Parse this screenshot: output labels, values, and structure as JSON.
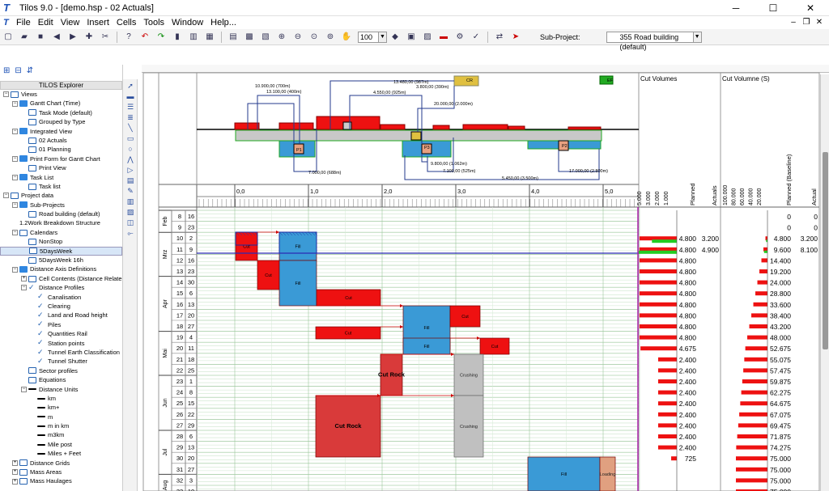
{
  "window": {
    "title": "Tilos 9.0 - [demo.hsp - 02 Actuals]",
    "minimize": "─",
    "maximize": "☐",
    "close": "✕"
  },
  "menu": [
    "File",
    "Edit",
    "View",
    "Insert",
    "Cells",
    "Tools",
    "Window",
    "Help..."
  ],
  "mdi": {
    "minimize": "–",
    "restore": "❐",
    "close": "✕"
  },
  "toolbar": {
    "zoom": "100",
    "subproject_label": "Sub-Project:",
    "subproject_value": "355 Road building (default)"
  },
  "explorer": {
    "header": "TILOS Explorer",
    "items": [
      {
        "t": "Views",
        "lvl": 0,
        "exp": "-",
        "ic": "doc"
      },
      {
        "t": "Gantt Chart (Time)",
        "lvl": 1,
        "exp": "-",
        "ic": "fold"
      },
      {
        "t": "Task Mode (default)",
        "lvl": 2,
        "ic": "doc"
      },
      {
        "t": "Grouped by Type",
        "lvl": 2,
        "ic": "doc"
      },
      {
        "t": "Integrated View",
        "lvl": 1,
        "exp": "-",
        "ic": "fold"
      },
      {
        "t": "02 Actuals",
        "lvl": 2,
        "ic": "doc"
      },
      {
        "t": "01 Planning",
        "lvl": 2,
        "ic": "doc"
      },
      {
        "t": "Print Form for Gantt Chart",
        "lvl": 1,
        "exp": "-",
        "ic": "fold"
      },
      {
        "t": "Print View",
        "lvl": 2,
        "ic": "doc"
      },
      {
        "t": "Task List",
        "lvl": 1,
        "exp": "-",
        "ic": "fold"
      },
      {
        "t": "Task list",
        "lvl": 2,
        "ic": "doc"
      },
      {
        "t": "Project data",
        "lvl": 0,
        "exp": "-",
        "ic": "doc"
      },
      {
        "t": "Sub-Projects",
        "lvl": 1,
        "exp": "-",
        "ic": "fold"
      },
      {
        "t": "Road building (default)",
        "lvl": 2,
        "ic": "doc"
      },
      {
        "t": "Work Breakdown Structure",
        "lvl": 1,
        "ic": "none",
        "pre": "1.2"
      },
      {
        "t": "Calendars",
        "lvl": 1,
        "exp": "-",
        "ic": "doc"
      },
      {
        "t": "NonStop",
        "lvl": 2,
        "ic": "doc"
      },
      {
        "t": "5DaysWeek",
        "lvl": 2,
        "ic": "doc",
        "sel": true
      },
      {
        "t": "5DaysWeek 16h",
        "lvl": 2,
        "ic": "doc"
      },
      {
        "t": "Distance Axis Definitions",
        "lvl": 1,
        "exp": "-",
        "ic": "fold"
      },
      {
        "t": "Cell Contents (Distance Relate",
        "lvl": 2,
        "exp": "+",
        "ic": "doc"
      },
      {
        "t": "Distance Profiles",
        "lvl": 2,
        "exp": "-",
        "ic": "chk"
      },
      {
        "t": "Canalisation",
        "lvl": 3,
        "ic": "chk"
      },
      {
        "t": "Clearing",
        "lvl": 3,
        "ic": "chk"
      },
      {
        "t": "Land and Road height",
        "lvl": 3,
        "ic": "chk"
      },
      {
        "t": "Piles",
        "lvl": 3,
        "ic": "chk"
      },
      {
        "t": "Quantities Rail",
        "lvl": 3,
        "ic": "chk"
      },
      {
        "t": "Station points",
        "lvl": 3,
        "ic": "chk"
      },
      {
        "t": "Tunnel Earth Classification",
        "lvl": 3,
        "ic": "chk"
      },
      {
        "t": "Tunnel Shutter",
        "lvl": 3,
        "ic": "chk"
      },
      {
        "t": "Sector profiles",
        "lvl": 2,
        "ic": "doc"
      },
      {
        "t": "Equations",
        "lvl": 2,
        "ic": "doc"
      },
      {
        "t": "Distance Units",
        "lvl": 2,
        "exp": "-",
        "ic": "line"
      },
      {
        "t": "km",
        "lvl": 3,
        "ic": "line"
      },
      {
        "t": "km+",
        "lvl": 3,
        "ic": "line"
      },
      {
        "t": "m",
        "lvl": 3,
        "ic": "line"
      },
      {
        "t": "m in km",
        "lvl": 3,
        "ic": "line"
      },
      {
        "t": "m3km",
        "lvl": 3,
        "ic": "line"
      },
      {
        "t": "Mile post",
        "lvl": 3,
        "ic": "line"
      },
      {
        "t": "Miles + Feet",
        "lvl": 3,
        "ic": "line"
      },
      {
        "t": "Distance Grids",
        "lvl": 1,
        "exp": "+",
        "ic": "doc"
      },
      {
        "t": "Mass Areas",
        "lvl": 1,
        "exp": "+",
        "ic": "doc"
      },
      {
        "t": "Mass Haulages",
        "lvl": 1,
        "exp": "+",
        "ic": "doc"
      }
    ]
  },
  "chart": {
    "distance_ticks": [
      "0,0",
      "1,0",
      "2,0",
      "3,0",
      "4,0",
      "5,0"
    ],
    "months": [
      {
        "label": "Feb",
        "weeks": [
          [
            "8",
            "16"
          ],
          [
            "9",
            "23"
          ]
        ]
      },
      {
        "label": "Mrz",
        "weeks": [
          [
            "10",
            "2"
          ],
          [
            "11",
            "9"
          ],
          [
            "12",
            "16"
          ],
          [
            "13",
            "23"
          ]
        ]
      },
      {
        "label": "Apr",
        "weeks": [
          [
            "14",
            "30"
          ],
          [
            "15",
            "6"
          ],
          [
            "16",
            "13"
          ],
          [
            "17",
            "20"
          ],
          [
            "18",
            "27"
          ]
        ]
      },
      {
        "label": "Mai",
        "weeks": [
          [
            "19",
            "4"
          ],
          [
            "20",
            "11"
          ],
          [
            "21",
            "18"
          ],
          [
            "22",
            "25"
          ]
        ]
      },
      {
        "label": "Jun",
        "weeks": [
          [
            "23",
            "1"
          ],
          [
            "24",
            "8"
          ],
          [
            "25",
            "15"
          ],
          [
            "26",
            "22"
          ],
          [
            "27",
            "29"
          ]
        ]
      },
      {
        "label": "Jul",
        "weeks": [
          [
            "28",
            "6"
          ],
          [
            "29",
            "13"
          ],
          [
            "30",
            "20"
          ],
          [
            "31",
            "27"
          ]
        ]
      },
      {
        "label": "Aug",
        "weeks": [
          [
            "32",
            "3"
          ],
          [
            "33",
            "10"
          ]
        ]
      }
    ],
    "top_labels": [
      {
        "t": "10.900,00 (700m)"
      },
      {
        "t": "13.100,00 (400m)"
      },
      {
        "t": "13.480,00 (987m)"
      },
      {
        "t": "3.800,00 (390m)"
      },
      {
        "t": "4.550,00 (925m)"
      },
      {
        "t": "20.000,00 (2.000m)"
      },
      {
        "t": "7.000,00 (688m)"
      },
      {
        "t": "9.800,00 (1.062m)"
      },
      {
        "t": "7.100,00 (525m)"
      },
      {
        "t": "5.450,00 (3.500m)"
      },
      {
        "t": "17.000,00 (2.800m)"
      },
      {
        "t": "CR"
      },
      {
        "t": "EF"
      },
      {
        "t": "P1"
      },
      {
        "t": "P2"
      },
      {
        "t": "P3"
      }
    ],
    "bars": [
      {
        "t": "Cut"
      },
      {
        "t": "Fill"
      },
      {
        "t": "Cut"
      },
      {
        "t": "Fill"
      },
      {
        "t": "Cut"
      },
      {
        "t": "Fill"
      },
      {
        "t": "Cut"
      },
      {
        "t": "Cut"
      },
      {
        "t": "Fill"
      },
      {
        "t": "Cut"
      },
      {
        "t": "Cut Rock"
      },
      {
        "t": "Crushing"
      },
      {
        "t": "Cut Rock"
      },
      {
        "t": "Crushing"
      },
      {
        "t": "Fill"
      },
      {
        "t": "Loading"
      }
    ]
  },
  "volumes": {
    "title_left": "Cut Volumes",
    "title_right": "Cut Volumne (S)",
    "axis_left": [
      "5.000",
      "3.000",
      "2.000",
      "1.000"
    ],
    "axis_right": [
      "100.000",
      "80.000",
      "60.000",
      "40.000",
      "20.000"
    ],
    "col_planned": "Planned",
    "col_actuals": "Actuals",
    "col_planned_baseline": "Planned (Baseline)",
    "col_actual": "Actual",
    "rows": [
      {
        "planned": "",
        "actuals": "",
        "pb": "0",
        "act": "0",
        "bar": 0,
        "act_bar": 0,
        "cum": 0
      },
      {
        "planned": "",
        "actuals": "",
        "pb": "0",
        "act": "0",
        "bar": 0,
        "act_bar": 0,
        "cum": 0
      },
      {
        "planned": "4.800",
        "actuals": "3.200",
        "pb": "4.800",
        "act": "3.200",
        "bar": 4800,
        "act_bar": 3200,
        "cum": 4800
      },
      {
        "planned": "4.800",
        "actuals": "4.900",
        "pb": "9.600",
        "act": "8.100",
        "bar": 4800,
        "act_bar": 4900,
        "cum": 9600
      },
      {
        "planned": "4.800",
        "actuals": "",
        "pb": "14.400",
        "act": "",
        "bar": 4800,
        "act_bar": 0,
        "cum": 14400
      },
      {
        "planned": "4.800",
        "actuals": "",
        "pb": "19.200",
        "act": "",
        "bar": 4800,
        "act_bar": 0,
        "cum": 19200
      },
      {
        "planned": "4.800",
        "actuals": "",
        "pb": "24.000",
        "act": "",
        "bar": 4800,
        "act_bar": 0,
        "cum": 24000
      },
      {
        "planned": "4.800",
        "actuals": "",
        "pb": "28.800",
        "act": "",
        "bar": 4800,
        "act_bar": 0,
        "cum": 28800
      },
      {
        "planned": "4.800",
        "actuals": "",
        "pb": "33.600",
        "act": "",
        "bar": 4800,
        "act_bar": 0,
        "cum": 33600
      },
      {
        "planned": "4.800",
        "actuals": "",
        "pb": "38.400",
        "act": "",
        "bar": 4800,
        "act_bar": 0,
        "cum": 38400
      },
      {
        "planned": "4.800",
        "actuals": "",
        "pb": "43.200",
        "act": "",
        "bar": 4800,
        "act_bar": 0,
        "cum": 43200
      },
      {
        "planned": "4.800",
        "actuals": "",
        "pb": "48.000",
        "act": "",
        "bar": 4800,
        "act_bar": 0,
        "cum": 48000
      },
      {
        "planned": "4.675",
        "actuals": "",
        "pb": "52.675",
        "act": "",
        "bar": 4675,
        "act_bar": 0,
        "cum": 52675
      },
      {
        "planned": "2.400",
        "actuals": "",
        "pb": "55.075",
        "act": "",
        "bar": 2400,
        "act_bar": 0,
        "cum": 55075
      },
      {
        "planned": "2.400",
        "actuals": "",
        "pb": "57.475",
        "act": "",
        "bar": 2400,
        "act_bar": 0,
        "cum": 57475
      },
      {
        "planned": "2.400",
        "actuals": "",
        "pb": "59.875",
        "act": "",
        "bar": 2400,
        "act_bar": 0,
        "cum": 59875
      },
      {
        "planned": "2.400",
        "actuals": "",
        "pb": "62.275",
        "act": "",
        "bar": 2400,
        "act_bar": 0,
        "cum": 62275
      },
      {
        "planned": "2.400",
        "actuals": "",
        "pb": "64.675",
        "act": "",
        "bar": 2400,
        "act_bar": 0,
        "cum": 64675
      },
      {
        "planned": "2.400",
        "actuals": "",
        "pb": "67.075",
        "act": "",
        "bar": 2400,
        "act_bar": 0,
        "cum": 67075
      },
      {
        "planned": "2.400",
        "actuals": "",
        "pb": "69.475",
        "act": "",
        "bar": 2400,
        "act_bar": 0,
        "cum": 69475
      },
      {
        "planned": "2.400",
        "actuals": "",
        "pb": "71.875",
        "act": "",
        "bar": 2400,
        "act_bar": 0,
        "cum": 71875
      },
      {
        "planned": "2.400",
        "actuals": "",
        "pb": "74.275",
        "act": "",
        "bar": 2400,
        "act_bar": 0,
        "cum": 74275
      },
      {
        "planned": "725",
        "actuals": "",
        "pb": "75.000",
        "act": "",
        "bar": 725,
        "act_bar": 0,
        "cum": 75000
      },
      {
        "planned": "",
        "actuals": "",
        "pb": "75.000",
        "act": "",
        "bar": 0,
        "act_bar": 0,
        "cum": 75000
      },
      {
        "planned": "",
        "actuals": "",
        "pb": "75.000",
        "act": "",
        "bar": 0,
        "act_bar": 0,
        "cum": 75000
      },
      {
        "planned": "",
        "actuals": "",
        "pb": "75.000",
        "act": "",
        "bar": 0,
        "act_bar": 0,
        "cum": 75000
      }
    ]
  },
  "colors": {
    "cut": "#ee1111",
    "fill": "#3a9ad6",
    "rock": "#d93a3a",
    "crush": "#c0c0c0",
    "loading": "#e0a080",
    "actual_bar": "#22cc22",
    "grid": "#cde6cd",
    "today": "#2a2ab5"
  }
}
